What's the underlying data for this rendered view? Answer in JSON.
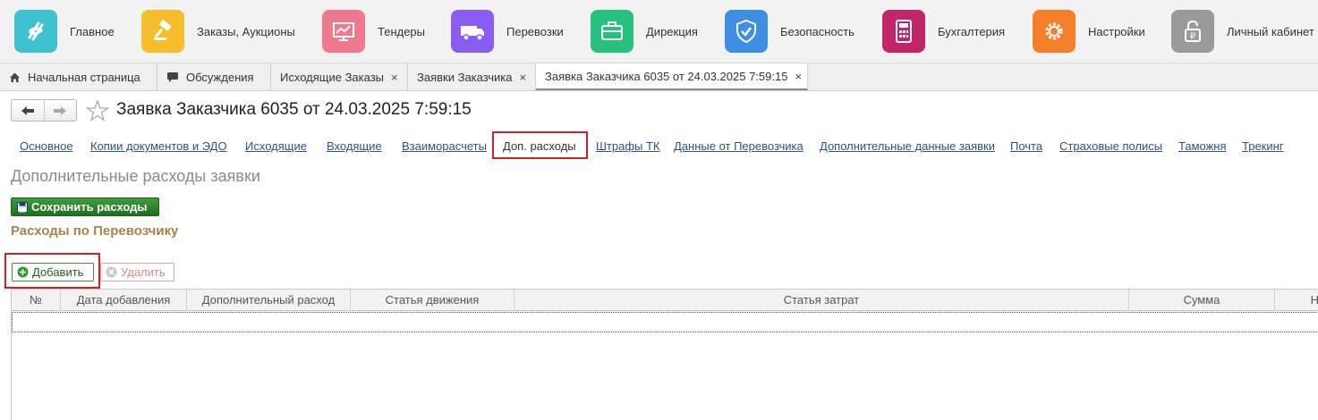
{
  "sections": [
    {
      "label": "Главное",
      "icon": "spiral-logo-icon",
      "color": "#3fc2cf"
    },
    {
      "label": "Заказы, Аукционы",
      "icon": "gavel-icon",
      "color": "#f6bd2d"
    },
    {
      "label": "Тендеры",
      "icon": "monitor-chart-icon",
      "color": "#f0788e"
    },
    {
      "label": "Перевозки",
      "icon": "truck-icon",
      "color": "#8b5cf0"
    },
    {
      "label": "Дирекция",
      "icon": "briefcase-icon",
      "color": "#27c07f"
    },
    {
      "label": "Безопасность",
      "icon": "shield-check-icon",
      "color": "#3e8ee6"
    },
    {
      "label": "Бухгалтерия",
      "icon": "calculator-icon",
      "color": "#c2266a"
    },
    {
      "label": "Настройки",
      "icon": "gear-icon",
      "color": "#f57e29"
    },
    {
      "label": "Личный кабинет",
      "icon": "lock-ruble-icon",
      "color": "#9a9a9a"
    }
  ],
  "open_tabs": [
    {
      "label": "Начальная страница",
      "icon": "home-icon"
    },
    {
      "label": "Обсуждения",
      "icon": "chat-icon"
    },
    {
      "label": "Исходящие Заказы",
      "close": "×"
    },
    {
      "label": "Заявки Заказчика",
      "close": "×"
    },
    {
      "label": "Заявка Заказчика 6035 от 24.03.2025 7:59:15",
      "close": "×",
      "active": true
    }
  ],
  "title": "Заявка Заказчика 6035 от 24.03.2025 7:59:15",
  "link_tabs": [
    "Основное",
    "Копии документов и ЭДО",
    "Исходящие",
    "Входящие",
    "Взаиморасчеты",
    "Доп. расходы",
    "Штрафы ТК",
    "Данные от Перевозчика",
    "Дополнительные данные заявки",
    "Почта",
    "Страховые полисы",
    "Таможня",
    "Трекинг"
  ],
  "selected_link_tab": "Доп. расходы",
  "section_title": "Дополнительные расходы заявки",
  "save_button": "Сохранить расходы",
  "subtitle": "Расходы по Перевозчику",
  "add_button": "Добавить",
  "delete_button": "Удалить",
  "table_columns": [
    "№",
    "Дата добавления",
    "Дополнительный расход",
    "Статья движения",
    "Статья затрат",
    "Сумма",
    "Н"
  ],
  "colors": {
    "highlight_red": "#d21f1f",
    "link_blue": "#2e4f8f",
    "save_green": "#2f8a2f",
    "subtitle_gold": "#a68548"
  }
}
